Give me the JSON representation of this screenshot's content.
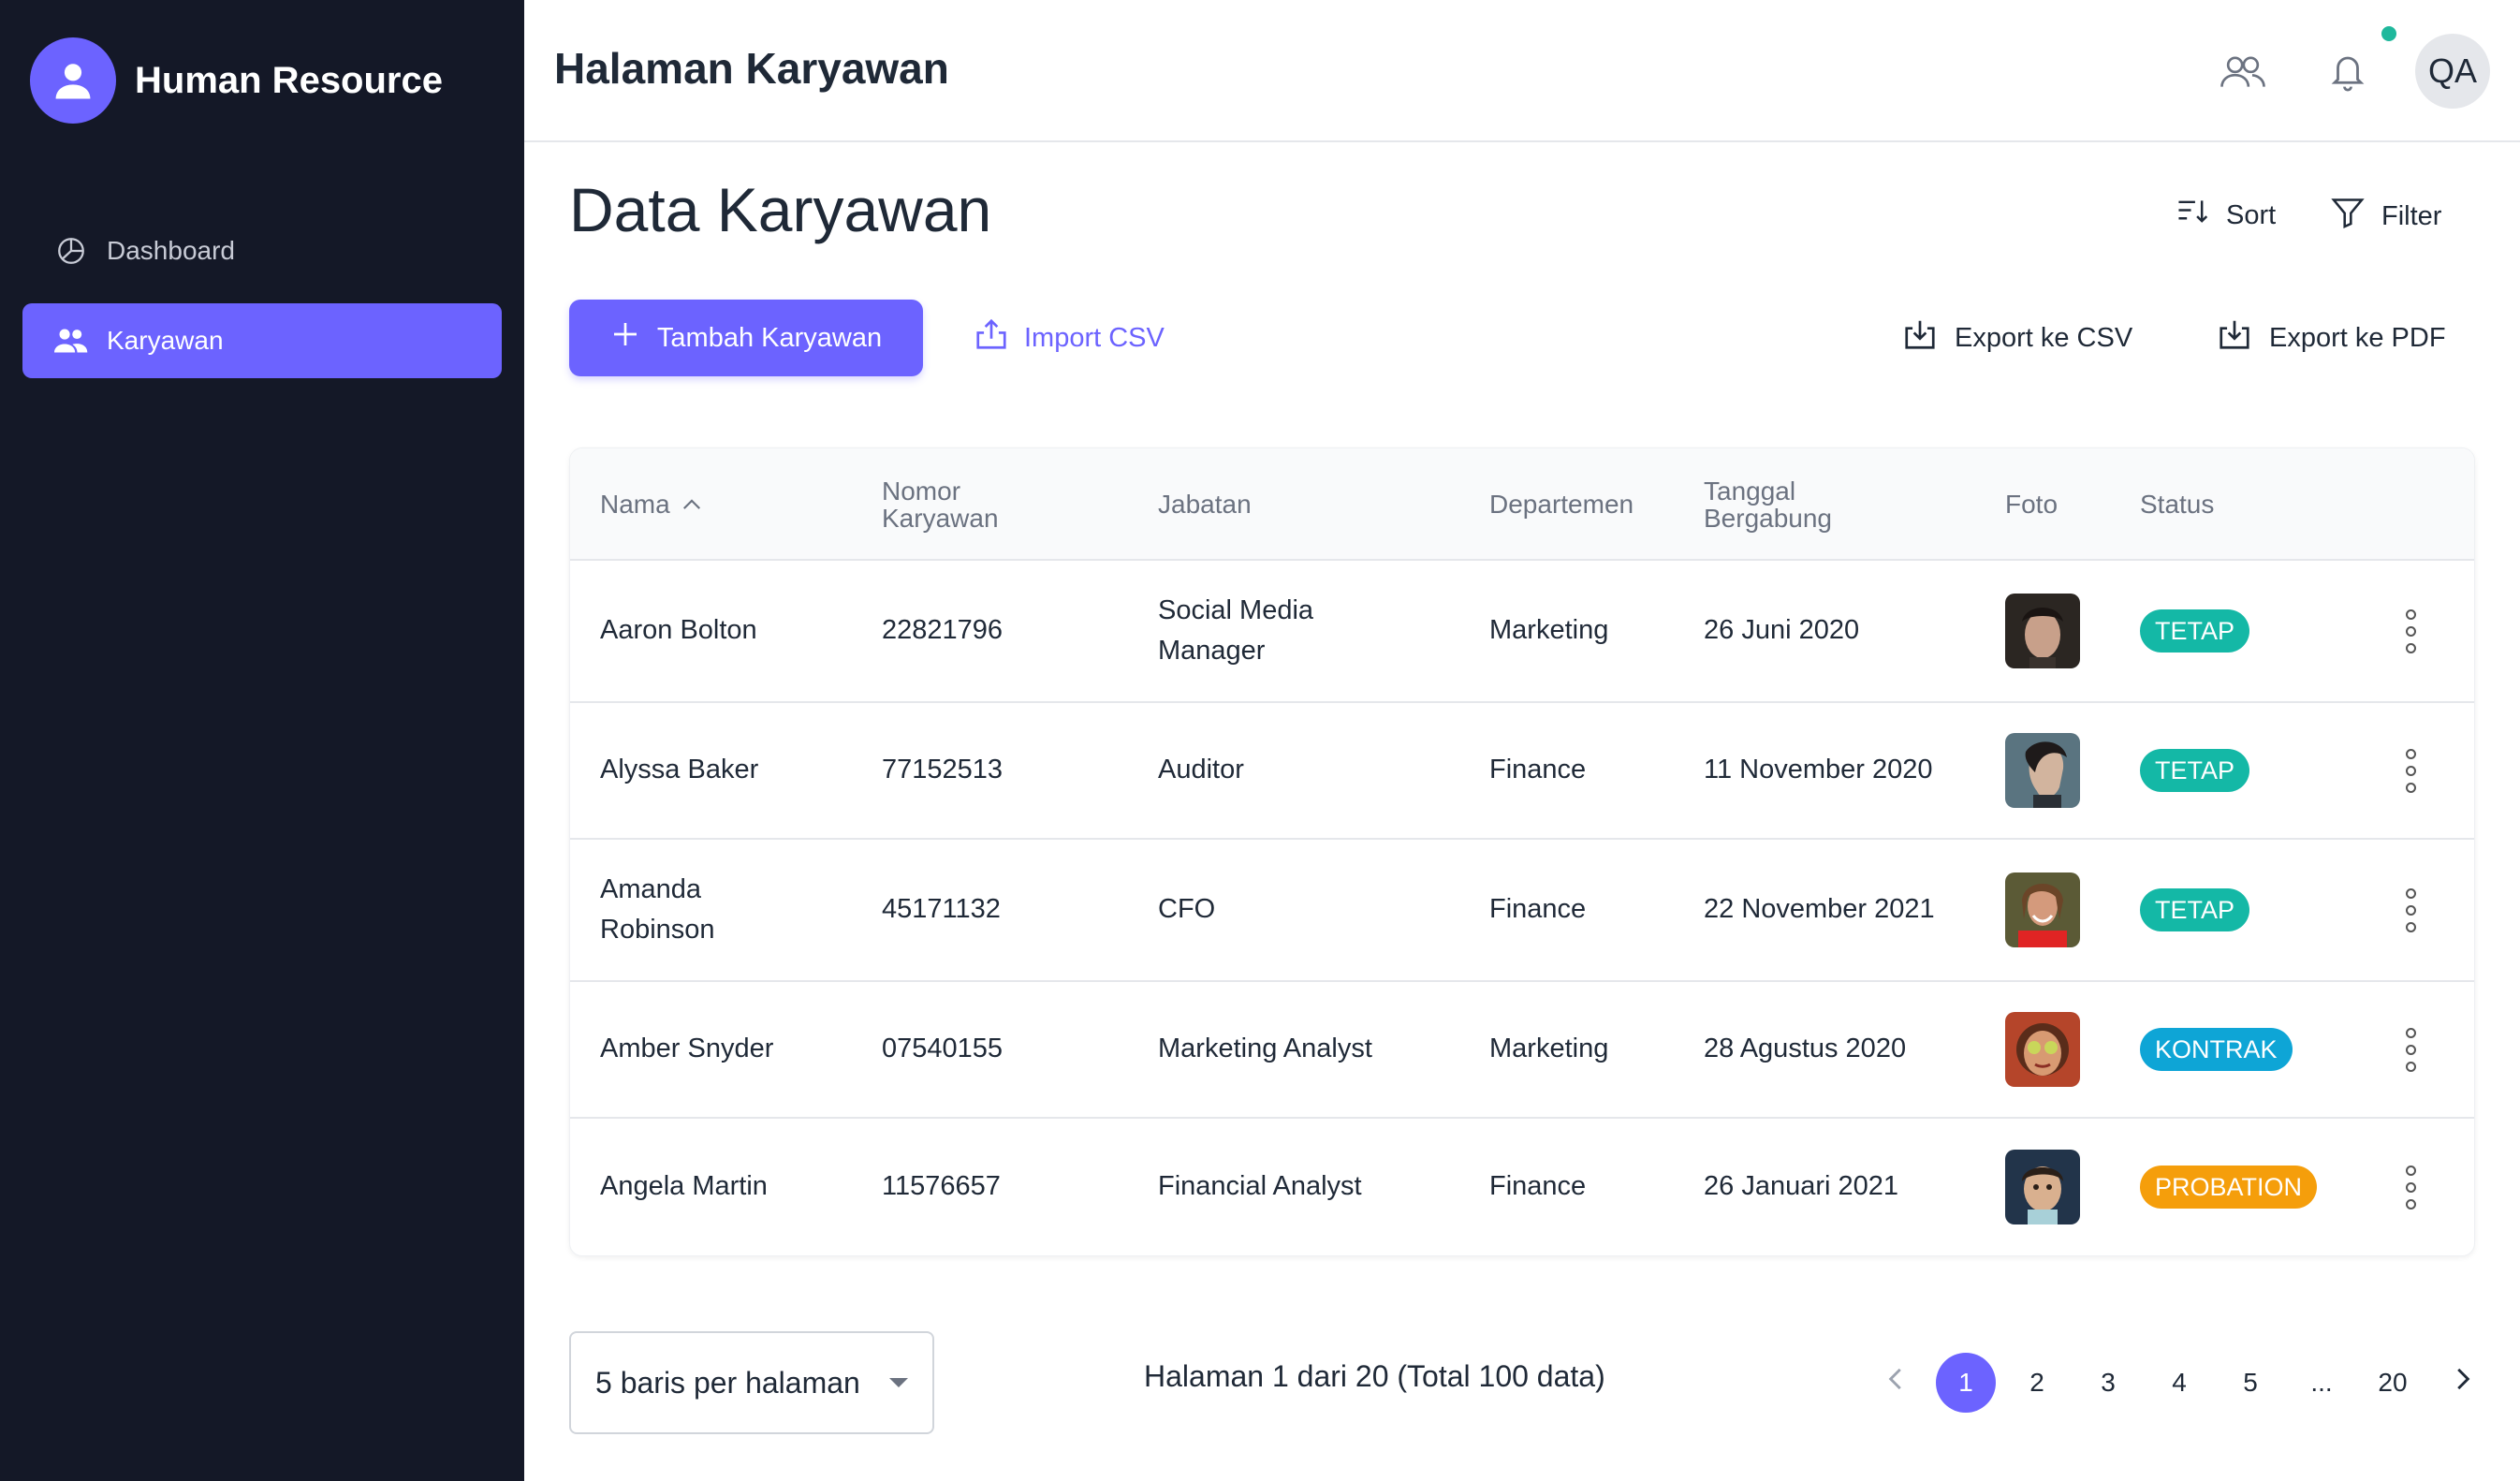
{
  "app": {
    "title": "Human Resource"
  },
  "sidebar": {
    "items": [
      {
        "label": "Dashboard",
        "icon": "pie-chart-icon",
        "active": false
      },
      {
        "label": "Karyawan",
        "icon": "users-icon",
        "active": true
      }
    ]
  },
  "header": {
    "title": "Halaman Karyawan",
    "user_initials": "QA"
  },
  "main": {
    "page_title": "Data Karyawan",
    "sort_label": "Sort",
    "filter_label": "Filter",
    "add_label": "Tambah Karyawan",
    "import_label": "Import CSV",
    "export_csv_label": "Export ke CSV",
    "export_pdf_label": "Export ke PDF"
  },
  "table": {
    "columns": [
      "Nama",
      "Nomor Karyawan",
      "Jabatan",
      "Departemen",
      "Tanggal Bergabung",
      "Foto",
      "Status"
    ],
    "column_lines": {
      "nomor": [
        "Nomor",
        "Karyawan"
      ],
      "tanggal": [
        "Tanggal",
        "Bergabung"
      ]
    },
    "rows": [
      {
        "nama": "Aaron Bolton",
        "nomor": "22821796",
        "jabatan": "Social Media Manager",
        "departemen": "Marketing",
        "tanggal": "26 Juni 2020",
        "status": "TETAP",
        "status_color": "#14b8a6"
      },
      {
        "nama": "Alyssa Baker",
        "nomor": "77152513",
        "jabatan": "Auditor",
        "departemen": "Finance",
        "tanggal": "11 November 2020",
        "status": "TETAP",
        "status_color": "#14b8a6"
      },
      {
        "nama": "Amanda Robinson",
        "nomor": "45171132",
        "jabatan": "CFO",
        "departemen": "Finance",
        "tanggal": "22 November 2021",
        "status": "TETAP",
        "status_color": "#14b8a6"
      },
      {
        "nama": "Amber Snyder",
        "nomor": "07540155",
        "jabatan": "Marketing Analyst",
        "departemen": "Marketing",
        "tanggal": "28 Agustus 2020",
        "status": "KONTRAK",
        "status_color": "#0ea5d6"
      },
      {
        "nama": "Angela Martin",
        "nomor": "11576657",
        "jabatan": "Financial Analyst",
        "departemen": "Finance",
        "tanggal": "26 Januari 2021",
        "status": "PROBATION",
        "status_color": "#f59e0b"
      }
    ]
  },
  "pagination": {
    "per_page_label": "5 baris per halaman",
    "info": "Halaman 1 dari 20 (Total 100 data)",
    "pages": [
      "1",
      "2",
      "3",
      "4",
      "5",
      "...",
      "20"
    ],
    "current": "1"
  },
  "colors": {
    "accent": "#6c63ff",
    "sidebar_bg": "#141827",
    "notif_dot": "#1fb89c"
  }
}
